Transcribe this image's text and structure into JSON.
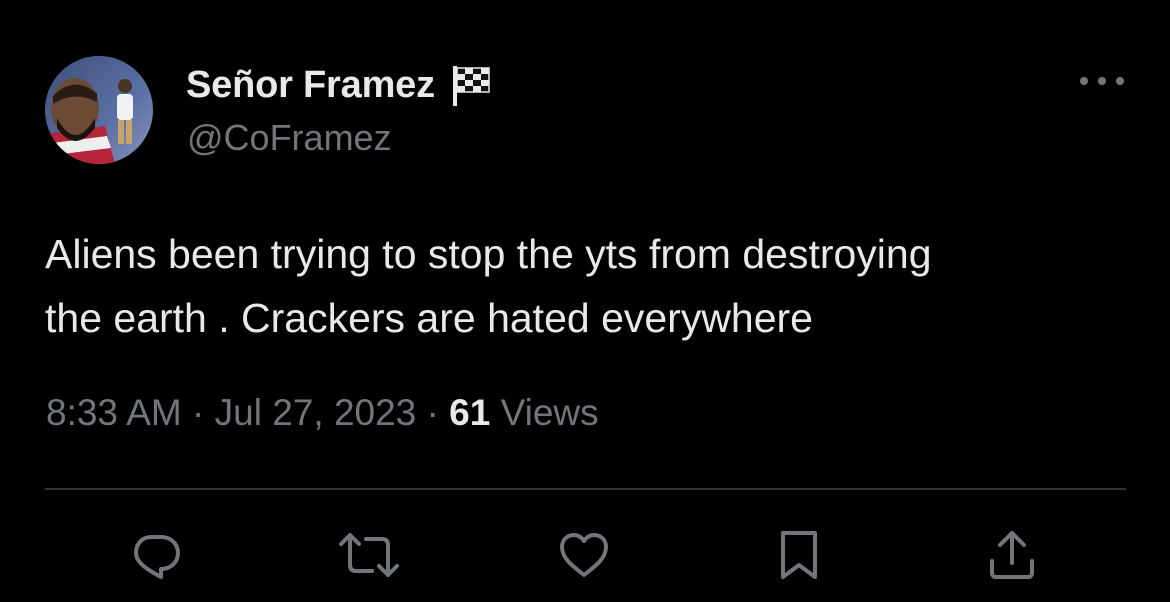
{
  "tweet": {
    "author": {
      "display_name": "Señor Framez",
      "badge_icon": "checkered-flag-icon",
      "handle": "@CoFramez"
    },
    "text_lines": [
      "Aliens been trying to stop the yts from destroying",
      "the earth . Crackers are hated everywhere"
    ],
    "time": "8:33 AM",
    "separator": "·",
    "date": "Jul 27, 2023",
    "views_count": "61",
    "views_label": "Views"
  },
  "actions": [
    {
      "name": "reply-icon"
    },
    {
      "name": "retweet-icon"
    },
    {
      "name": "like-icon"
    },
    {
      "name": "bookmark-icon"
    },
    {
      "name": "share-icon"
    }
  ],
  "colors": {
    "background": "#000000",
    "primary_text": "#e7e9ea",
    "secondary_text": "#71767b",
    "divider": "#2f3336"
  }
}
